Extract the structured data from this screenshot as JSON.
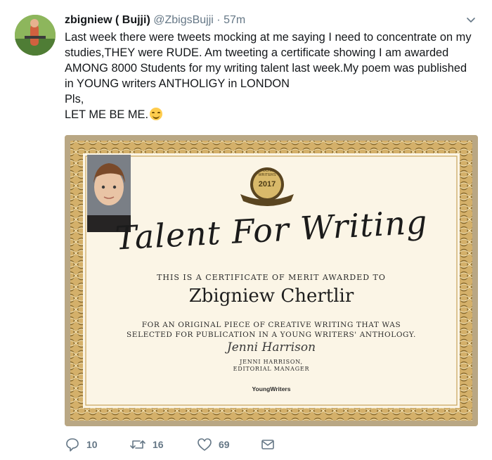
{
  "tweet": {
    "display_name": "zbigniew ( Bujji)",
    "handle": "@ZbigsBujji",
    "separator": "·",
    "timestamp": "57m",
    "text_lines": [
      "Last week there were tweets mocking at me saying I need to concentrate on my",
      "studies,THEY were RUDE. Am tweeting a certificate showing I am awarded",
      "AMONG 8000 Students for my writing talent last week.My poem was published",
      "in YOUNG writers ANTHOLIGY in LONDON",
      "Pls,",
      "LET ME BE ME."
    ],
    "emoji": "smiling-face-with-smiling-eyes"
  },
  "certificate": {
    "seal_top": "YOUNG WRITERS",
    "seal_year": "2017",
    "title": "Talent For Writing",
    "line1": "THIS IS A CERTIFICATE OF MERIT AWARDED TO",
    "recipient": "Zbigniew Chertlir",
    "line2": "FOR AN ORIGINAL PIECE OF CREATIVE WRITING THAT WAS",
    "line3": "SELECTED FOR PUBLICATION IN A YOUNG WRITERS' ANTHOLOGY.",
    "signature": "Jenni Harrison",
    "signer_name": "JENNI HARRISON,",
    "signer_role": "EDITORIAL MANAGER",
    "brand": "YoungWriters"
  },
  "actions": {
    "replies": "10",
    "retweets": "16",
    "likes": "69"
  },
  "colors": {
    "text": "#14171a",
    "muted": "#657786",
    "certificate_border": "#c9b998",
    "certificate_paper": "#fbf5e6",
    "emoji": "#ffcc4d"
  }
}
